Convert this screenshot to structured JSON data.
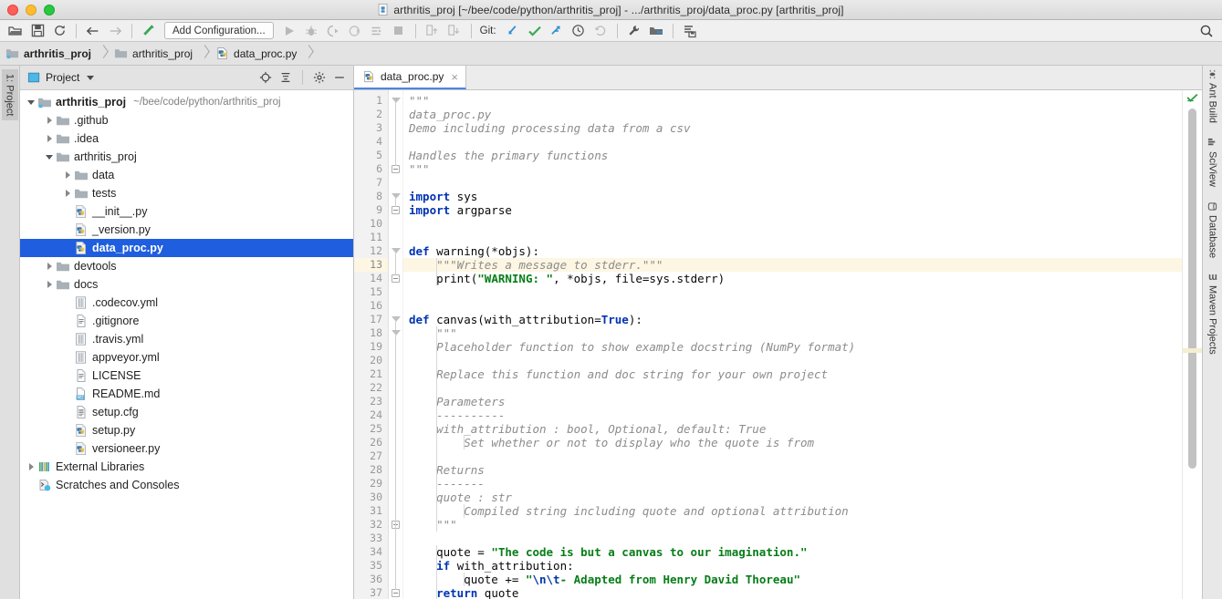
{
  "window": {
    "title": "arthritis_proj [~/bee/code/python/arthritis_proj] - .../arthritis_proj/data_proc.py [arthritis_proj]",
    "traffic_lights": [
      "close-button",
      "minimize-button",
      "maximize-button"
    ]
  },
  "toolbar": {
    "items": [
      {
        "name": "open-project-icon",
        "label": "Open"
      },
      {
        "name": "save-all-icon",
        "label": "Save All"
      },
      {
        "name": "sync-icon",
        "label": "Synchronize"
      },
      {
        "name": "back-icon",
        "label": "Back"
      },
      {
        "name": "forward-icon",
        "label": "Forward"
      },
      {
        "name": "search-everywhere-icon",
        "label": "Search Everywhere"
      }
    ],
    "run_config_label": "Add Configuration...",
    "run_items": [
      {
        "name": "run-icon",
        "label": "Run"
      },
      {
        "name": "debug-icon",
        "label": "Debug"
      },
      {
        "name": "run-coverage-icon",
        "label": "Run with Coverage"
      },
      {
        "name": "profile-icon",
        "label": "Profile"
      },
      {
        "name": "run-with-console-icon",
        "label": "Run with Console"
      },
      {
        "name": "stop-icon",
        "label": "Stop"
      }
    ],
    "deploy_items": [
      {
        "name": "upload-icon",
        "label": "Upload"
      },
      {
        "name": "download-icon",
        "label": "Download"
      }
    ],
    "git_label": "Git:",
    "git_items": [
      {
        "name": "git-update-icon",
        "label": "Update Project"
      },
      {
        "name": "git-commit-icon",
        "label": "Commit"
      },
      {
        "name": "git-push-icon",
        "label": "Push"
      },
      {
        "name": "git-history-icon",
        "label": "History"
      },
      {
        "name": "git-rollback-icon",
        "label": "Rollback"
      }
    ],
    "right_items": [
      {
        "name": "settings-wrench-icon",
        "label": "Settings"
      },
      {
        "name": "project-structure-icon",
        "label": "Project Structure"
      },
      {
        "name": "database-sync-icon",
        "label": "Sync Database"
      }
    ],
    "search_icon": "search-icon"
  },
  "breadcrumbs": [
    {
      "label": "arthritis_proj",
      "icon": "project-folder-icon",
      "bold": true
    },
    {
      "label": "arthritis_proj",
      "icon": "folder-icon",
      "bold": false
    },
    {
      "label": "data_proc.py",
      "icon": "python-file-icon",
      "bold": false
    }
  ],
  "left_strip": {
    "tabs": [
      {
        "label": "1: Project",
        "active": true
      }
    ]
  },
  "right_strip": {
    "tabs": [
      {
        "label": "Ant Build",
        "icon": "ant-icon"
      },
      {
        "label": "SciView",
        "icon": "sciview-icon"
      },
      {
        "label": "Database",
        "icon": "database-icon"
      },
      {
        "label": "Maven Projects",
        "icon": "maven-icon"
      }
    ]
  },
  "project_panel": {
    "title": "Project",
    "title_icon": "project-view-icon",
    "actions": [
      {
        "name": "locate-icon",
        "label": "Select Opened File"
      },
      {
        "name": "collapse-all-icon",
        "label": "Collapse All"
      },
      {
        "name": "settings-gear-icon",
        "label": "Settings"
      },
      {
        "name": "hide-icon",
        "label": "Hide"
      }
    ],
    "tree": [
      {
        "label": "arthritis_proj",
        "path": "~/bee/code/python/arthritis_proj",
        "indent": 0,
        "twist": "open",
        "icon": "project-folder-icon",
        "bold": true,
        "selected": false
      },
      {
        "label": ".github",
        "path": "",
        "indent": 1,
        "twist": "closed",
        "icon": "folder-icon",
        "bold": false,
        "selected": false
      },
      {
        "label": ".idea",
        "path": "",
        "indent": 1,
        "twist": "closed",
        "icon": "folder-icon",
        "bold": false,
        "selected": false
      },
      {
        "label": "arthritis_proj",
        "path": "",
        "indent": 1,
        "twist": "open",
        "icon": "folder-icon",
        "bold": false,
        "selected": false
      },
      {
        "label": "data",
        "path": "",
        "indent": 2,
        "twist": "closed",
        "icon": "folder-icon",
        "bold": false,
        "selected": false
      },
      {
        "label": "tests",
        "path": "",
        "indent": 2,
        "twist": "closed",
        "icon": "folder-icon",
        "bold": false,
        "selected": false
      },
      {
        "label": "__init__.py",
        "path": "",
        "indent": 2,
        "twist": "none",
        "icon": "python-file-icon",
        "bold": false,
        "selected": false
      },
      {
        "label": "_version.py",
        "path": "",
        "indent": 2,
        "twist": "none",
        "icon": "python-file-icon",
        "bold": false,
        "selected": false
      },
      {
        "label": "data_proc.py",
        "path": "",
        "indent": 2,
        "twist": "none",
        "icon": "python-file-icon",
        "bold": true,
        "selected": true
      },
      {
        "label": "devtools",
        "path": "",
        "indent": 1,
        "twist": "closed",
        "icon": "folder-icon",
        "bold": false,
        "selected": false
      },
      {
        "label": "docs",
        "path": "",
        "indent": 1,
        "twist": "closed",
        "icon": "folder-icon",
        "bold": false,
        "selected": false
      },
      {
        "label": ".codecov.yml",
        "path": "",
        "indent": 2,
        "twist": "none",
        "icon": "yaml-file-icon",
        "bold": false,
        "selected": false
      },
      {
        "label": ".gitignore",
        "path": "",
        "indent": 2,
        "twist": "none",
        "icon": "text-file-icon",
        "bold": false,
        "selected": false
      },
      {
        "label": ".travis.yml",
        "path": "",
        "indent": 2,
        "twist": "none",
        "icon": "yaml-file-icon",
        "bold": false,
        "selected": false
      },
      {
        "label": "appveyor.yml",
        "path": "",
        "indent": 2,
        "twist": "none",
        "icon": "yaml-file-icon",
        "bold": false,
        "selected": false
      },
      {
        "label": "LICENSE",
        "path": "",
        "indent": 2,
        "twist": "none",
        "icon": "text-file-icon",
        "bold": false,
        "selected": false
      },
      {
        "label": "README.md",
        "path": "",
        "indent": 2,
        "twist": "none",
        "icon": "markdown-file-icon",
        "bold": false,
        "selected": false
      },
      {
        "label": "setup.cfg",
        "path": "",
        "indent": 2,
        "twist": "none",
        "icon": "config-file-icon",
        "bold": false,
        "selected": false
      },
      {
        "label": "setup.py",
        "path": "",
        "indent": 2,
        "twist": "none",
        "icon": "python-file-icon",
        "bold": false,
        "selected": false
      },
      {
        "label": "versioneer.py",
        "path": "",
        "indent": 2,
        "twist": "none",
        "icon": "python-file-icon",
        "bold": false,
        "selected": false
      },
      {
        "label": "External Libraries",
        "path": "",
        "indent": 0,
        "twist": "closed",
        "icon": "external-libraries-icon",
        "bold": false,
        "selected": false
      },
      {
        "label": "Scratches and Consoles",
        "path": "",
        "indent": 0,
        "twist": "none",
        "icon": "scratches-icon",
        "bold": false,
        "selected": false
      }
    ]
  },
  "editor": {
    "tabs": [
      {
        "label": "data_proc.py",
        "icon": "python-file-icon",
        "close": "×",
        "active": true
      }
    ],
    "inspection_status": "ok-check-icon",
    "caret_line": 13,
    "first_line": 1,
    "last_line": 37,
    "lines": [
      {
        "n": 1,
        "text": "\"\"\"",
        "fold": "tri-open"
      },
      {
        "n": 2,
        "text": "data_proc.py"
      },
      {
        "n": 3,
        "text": "Demo including processing data from a csv"
      },
      {
        "n": 4,
        "text": ""
      },
      {
        "n": 5,
        "text": "Handles the primary functions"
      },
      {
        "n": 6,
        "text": "\"\"\"",
        "fold": "minus"
      },
      {
        "n": 7,
        "text": ""
      },
      {
        "n": 8,
        "text": "import sys",
        "fold": "tri-open"
      },
      {
        "n": 9,
        "text": "import argparse",
        "fold": "minus"
      },
      {
        "n": 10,
        "text": ""
      },
      {
        "n": 11,
        "text": ""
      },
      {
        "n": 12,
        "text": "def warning(*objs):",
        "fold": "tri-open"
      },
      {
        "n": 13,
        "text": "    \"\"\"Writes a message to stderr.\"\"\""
      },
      {
        "n": 14,
        "text": "    print(\"WARNING: \", *objs, file=sys.stderr)",
        "fold": "minus"
      },
      {
        "n": 15,
        "text": ""
      },
      {
        "n": 16,
        "text": ""
      },
      {
        "n": 17,
        "text": "def canvas(with_attribution=True):",
        "fold": "tri-open"
      },
      {
        "n": 18,
        "text": "    \"\"\"",
        "fold": "tri-open"
      },
      {
        "n": 19,
        "text": "    Placeholder function to show example docstring (NumPy format)"
      },
      {
        "n": 20,
        "text": ""
      },
      {
        "n": 21,
        "text": "    Replace this function and doc string for your own project"
      },
      {
        "n": 22,
        "text": ""
      },
      {
        "n": 23,
        "text": "    Parameters"
      },
      {
        "n": 24,
        "text": "    ----------"
      },
      {
        "n": 25,
        "text": "    with_attribution : bool, Optional, default: True"
      },
      {
        "n": 26,
        "text": "        Set whether or not to display who the quote is from"
      },
      {
        "n": 27,
        "text": ""
      },
      {
        "n": 28,
        "text": "    Returns"
      },
      {
        "n": 29,
        "text": "    -------"
      },
      {
        "n": 30,
        "text": "    quote : str"
      },
      {
        "n": 31,
        "text": "        Compiled string including quote and optional attribution"
      },
      {
        "n": 32,
        "text": "    \"\"\"",
        "fold": "minus"
      },
      {
        "n": 33,
        "text": ""
      },
      {
        "n": 34,
        "text": "    quote = \"The code is but a canvas to our imagination.\""
      },
      {
        "n": 35,
        "text": "    if with_attribution:"
      },
      {
        "n": 36,
        "text": "        quote += \"\\n\\t- Adapted from Henry David Thoreau\""
      },
      {
        "n": 37,
        "text": "    return quote",
        "fold": "minus"
      }
    ]
  },
  "colors": {
    "selection_blue": "#1f5ede",
    "caret_line": "#fdf6e3",
    "keyword": "#0033b3",
    "string": "#067d17",
    "docstring": "#8c8c8c",
    "function": "#00627a",
    "accent_tab": "#4a86e8",
    "ok_green": "#27a327"
  }
}
